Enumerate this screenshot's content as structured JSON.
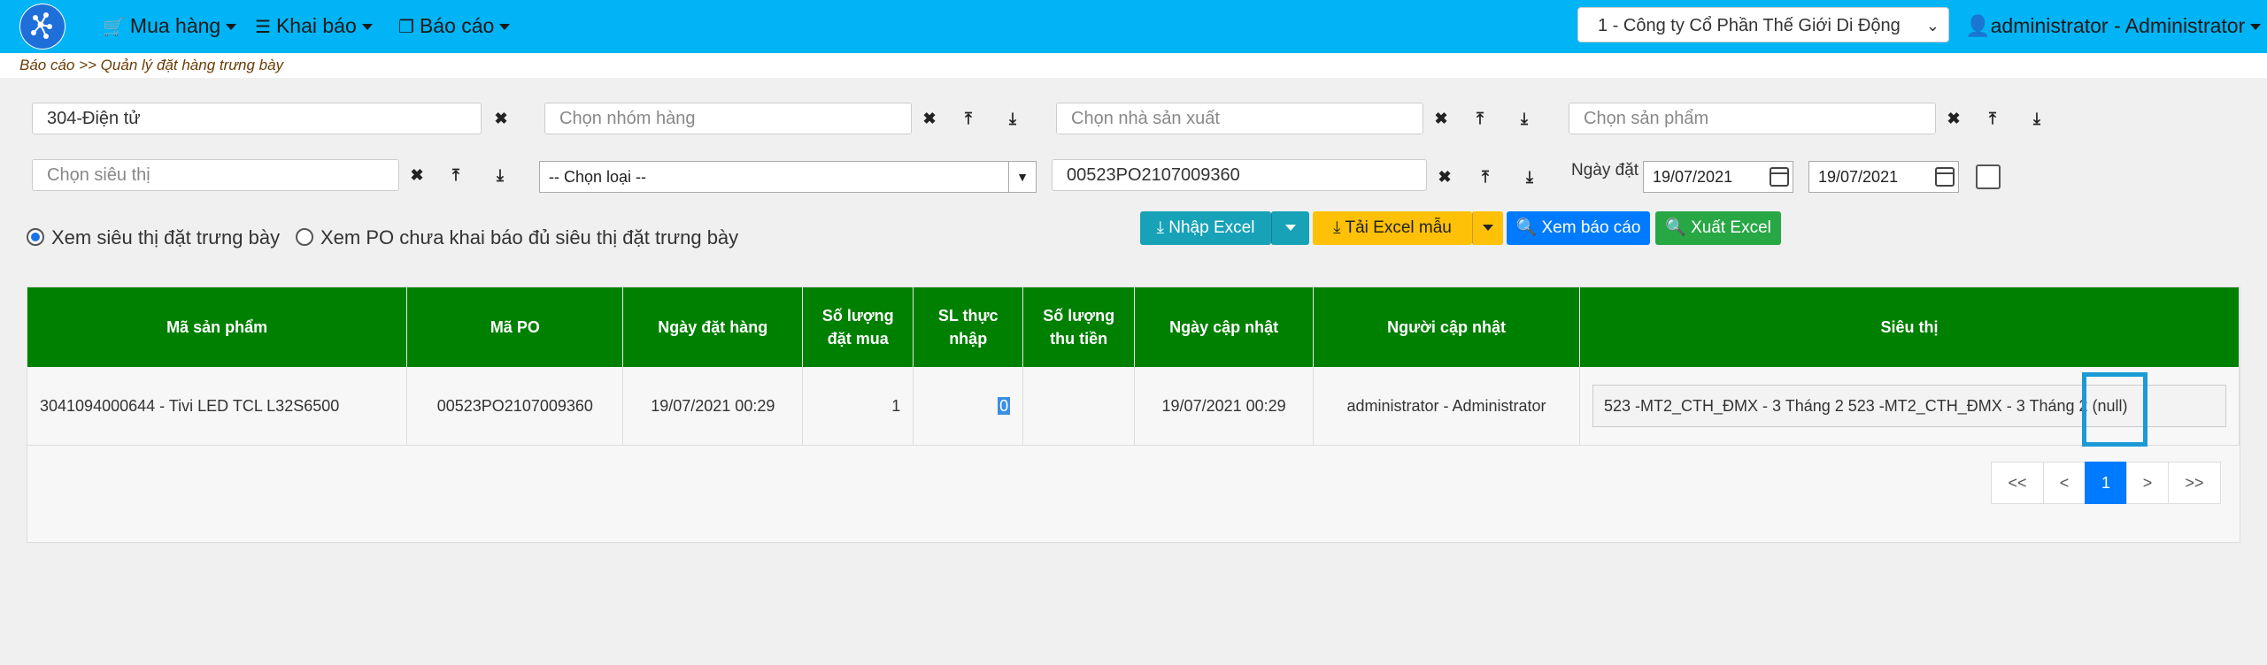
{
  "nav": {
    "menu_purchase": "Mua hàng",
    "menu_declare": "Khai báo",
    "menu_report": "Báo cáo",
    "company": "1 - Công ty Cổ Phần Thế Giới Di Động",
    "user": "administrator - Administrator"
  },
  "breadcrumb": "Báo cáo >> Quản lý đặt hàng trưng bày",
  "filters": {
    "department": "304-Điện tử",
    "product_group_placeholder": "Chọn nhóm hàng",
    "manufacturer_placeholder": "Chọn nhà sản xuất",
    "product_placeholder": "Chọn sản phẩm",
    "store_placeholder": "Chọn siêu thị",
    "type_select": "-- Chọn loại --",
    "po_number": "00523PO2107009360",
    "date_label": "Ngày đặt",
    "date_from": "19/07/2021",
    "date_to": "19/07/2021"
  },
  "radios": {
    "option1": "Xem siêu thị đặt trưng bày",
    "option2": "Xem PO chưa khai báo đủ siêu thị đặt trưng bày",
    "selected": "option1"
  },
  "buttons": {
    "import_excel": "Nhập Excel",
    "download_template": "Tải Excel mẫu",
    "view_report": "Xem báo cáo",
    "export_excel": "Xuất Excel"
  },
  "table": {
    "headers": {
      "product_code": "Mã sản phẩm",
      "po_code": "Mã PO",
      "order_date": "Ngày đặt hàng",
      "qty_ordered_1": "Số lượng",
      "qty_ordered_2": "đặt mua",
      "qty_actual_1": "SL thực",
      "qty_actual_2": "nhập",
      "qty_collected_1": "Số lượng",
      "qty_collected_2": "thu tiền",
      "updated_date": "Ngày cập nhật",
      "updated_by": "Người cập nhật",
      "store": "Siêu thị"
    },
    "rows": [
      {
        "product": "3041094000644 - Tivi LED TCL L32S6500",
        "po": "00523PO2107009360",
        "order_date": "19/07/2021 00:29",
        "qty_ordered": "1",
        "qty_actual": "0",
        "qty_collected": "",
        "updated_date": "19/07/2021 00:29",
        "updated_by": "administrator - Administrator",
        "store": "523 -MT2_CTH_ĐMX - 3 Tháng 2 523 -MT2_CTH_ĐMX - 3 Tháng 2 (null)"
      }
    ]
  },
  "pagination": {
    "first": "<<",
    "prev": "<",
    "current": "1",
    "next": ">",
    "last": ">>"
  },
  "colors": {
    "navbar": "#00b4f5",
    "table_header": "#008000",
    "highlight": "#1b9ad6"
  }
}
